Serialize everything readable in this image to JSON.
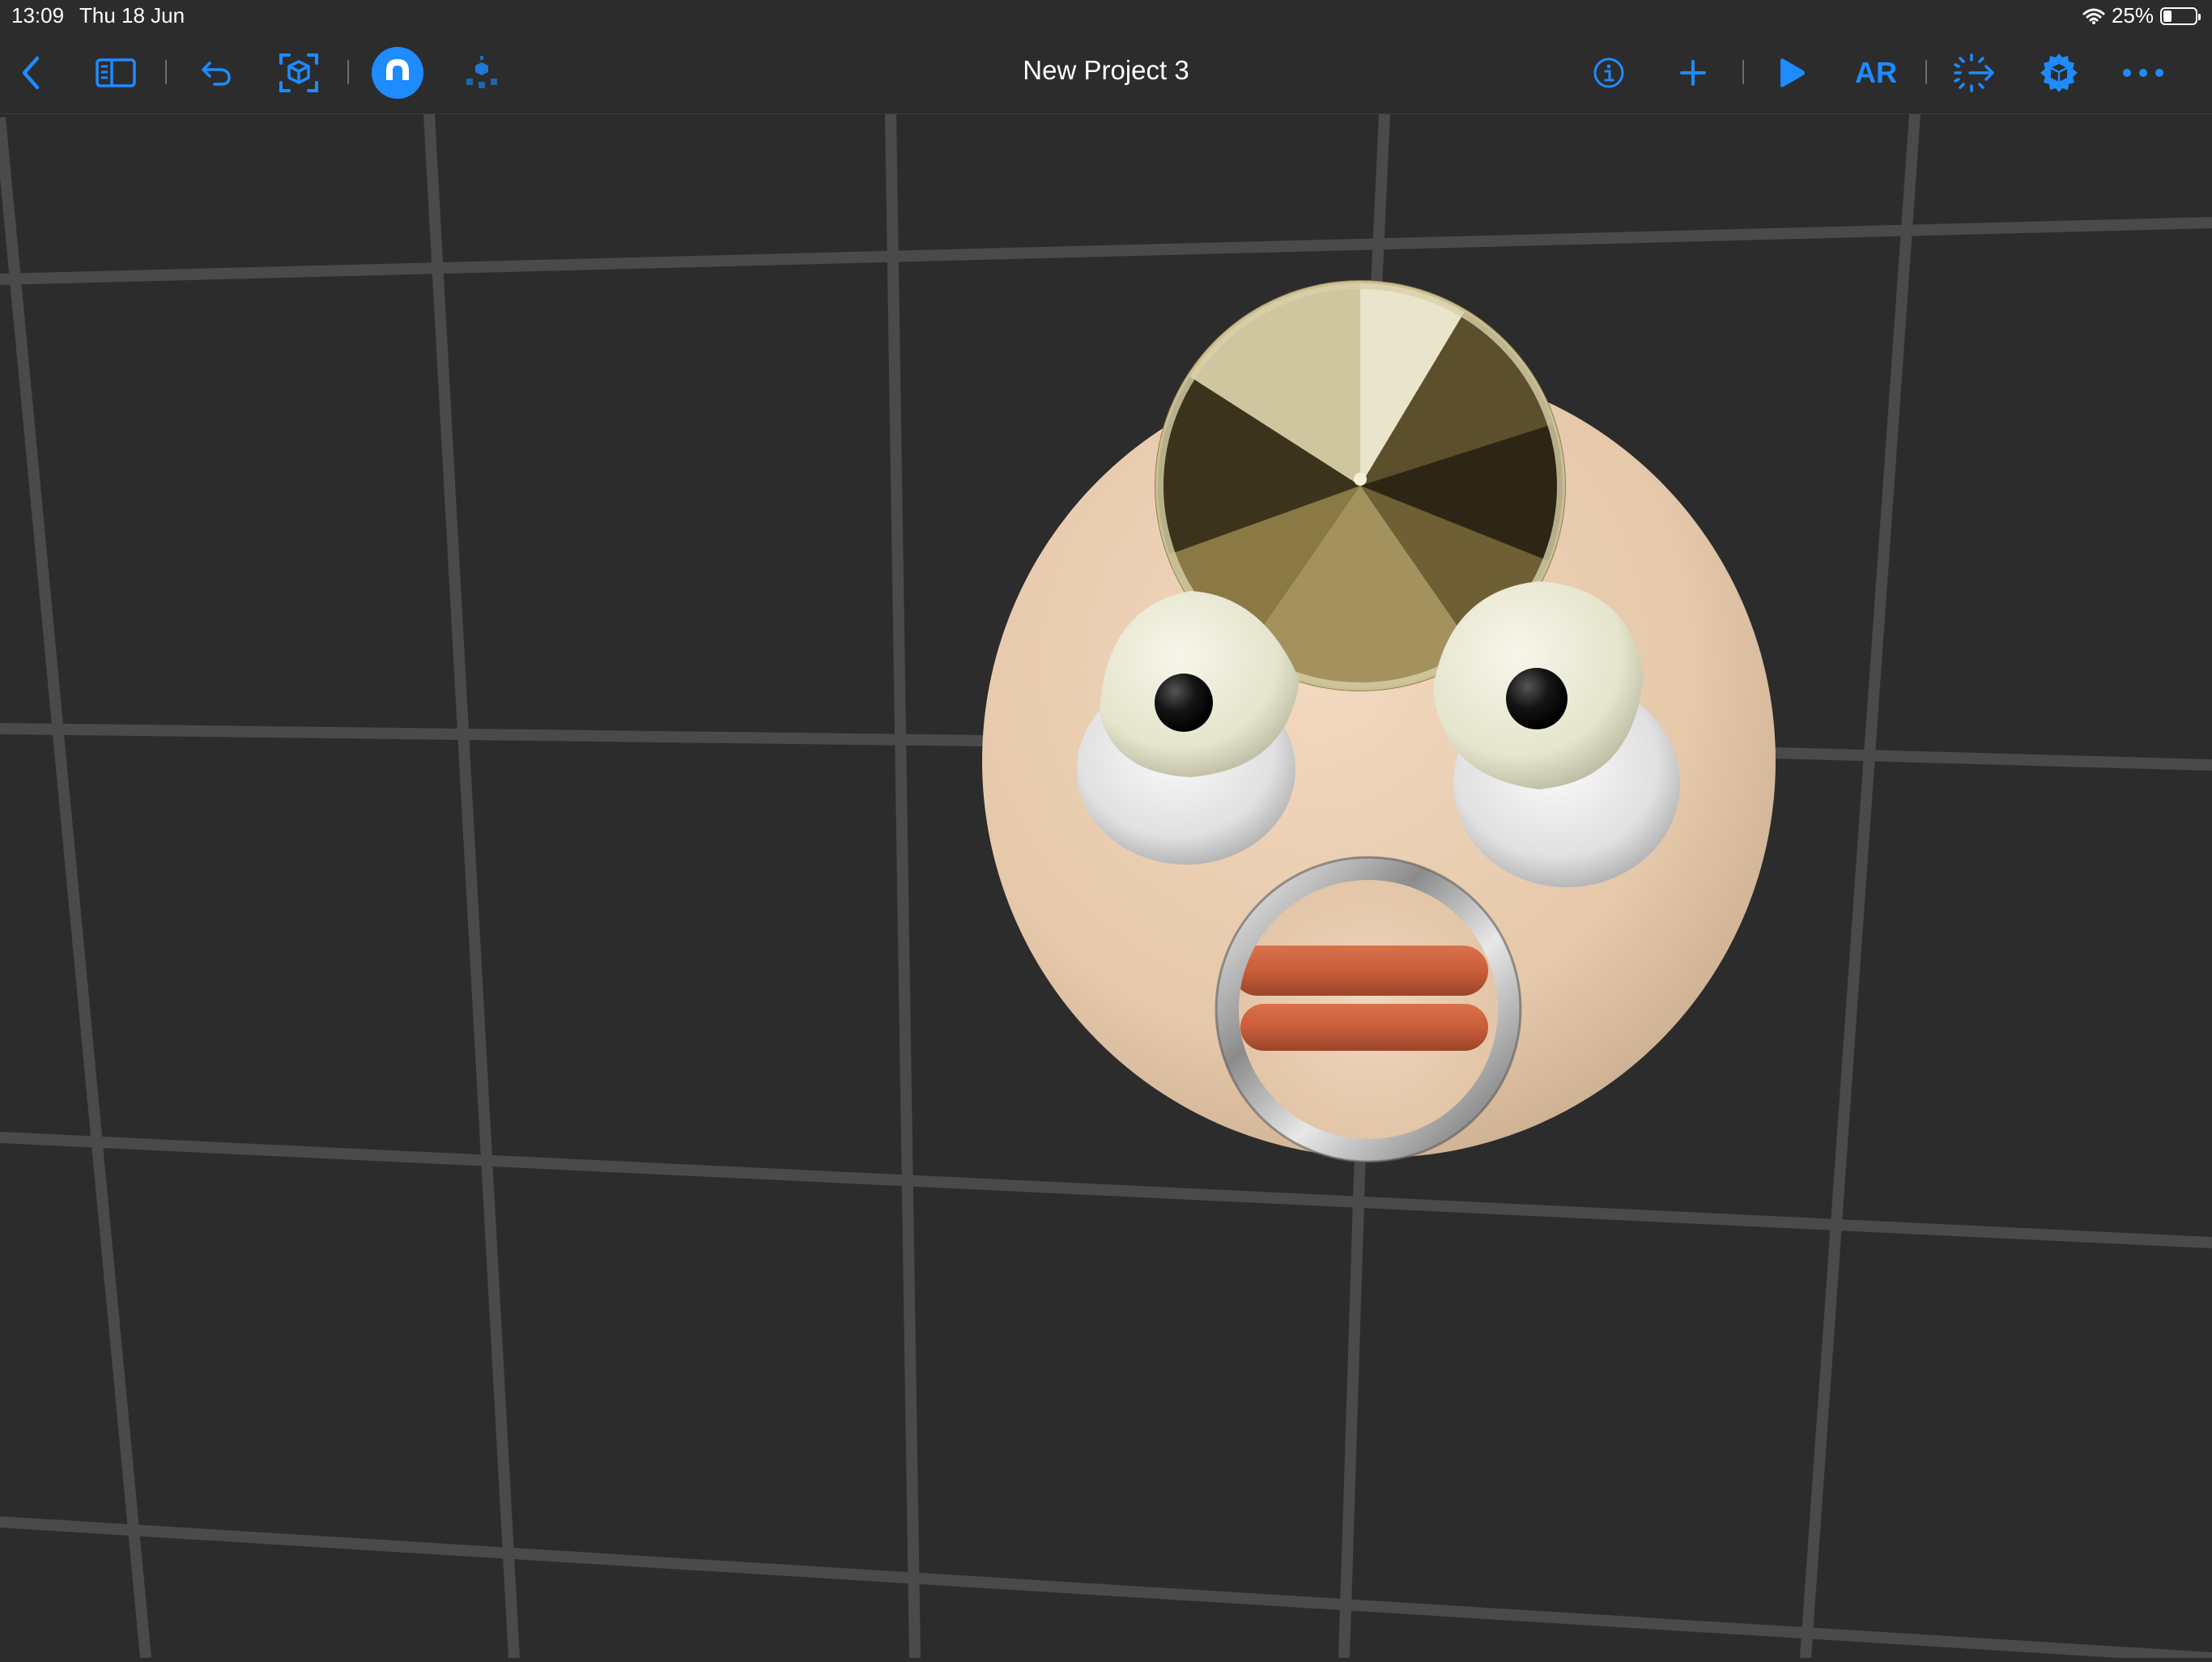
{
  "status_bar": {
    "time": "13:09",
    "date": "Thu 18 Jun",
    "battery_percent": "25%",
    "battery_level": 0.25
  },
  "toolbar": {
    "title": "New Project 3",
    "ar_label": "AR",
    "accent_color": "#1e8bff",
    "left_icons": [
      "back-chevron-icon",
      "sidebar-toggle-icon",
      "undo-icon",
      "scene-anchor-icon",
      "snap-magnet-icon",
      "physics-blocks-icon"
    ],
    "right_icons": [
      "info-icon",
      "add-icon",
      "play-icon",
      "ar-button",
      "send-to-device-icon",
      "settings-cube-icon",
      "more-icon"
    ]
  },
  "scene": {
    "background_color": "#2c2c2d",
    "grid_color": "#4a4a4c",
    "objects": [
      {
        "name": "head-sphere",
        "color": "#e9cdb2"
      },
      {
        "name": "gold-cone-hat",
        "color": "#b8a166"
      },
      {
        "name": "left-eye",
        "color": "#e8e6d8"
      },
      {
        "name": "right-eye",
        "color": "#e8e6d8"
      },
      {
        "name": "pupils",
        "color": "#111111"
      },
      {
        "name": "silver-ring-mouth",
        "color": "#c8c8c8"
      },
      {
        "name": "orange-lips",
        "color": "#c95e3a"
      }
    ]
  }
}
